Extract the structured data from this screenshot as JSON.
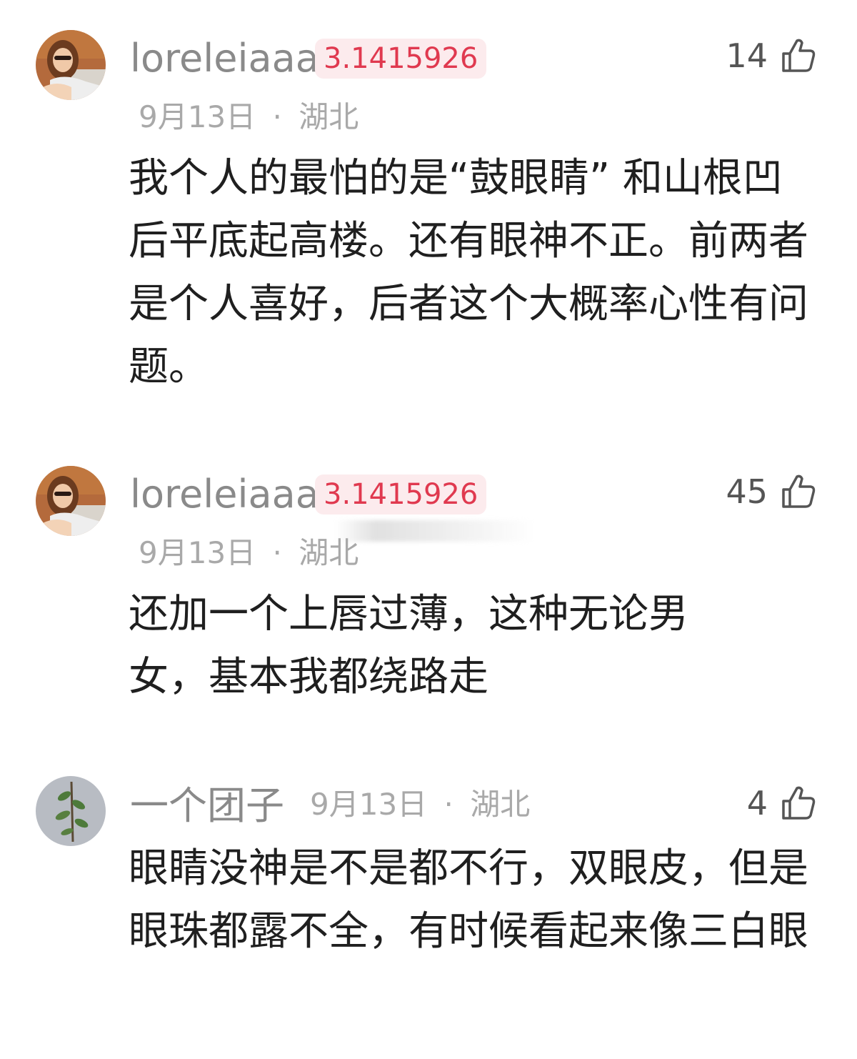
{
  "comments": [
    {
      "avatar_icon": "user-avatar-photo",
      "username": "loreleiaaa",
      "badge": "3.1415926",
      "likes": "14",
      "date": "9月13日",
      "separator": "·",
      "location": "湖北",
      "text": "我个人的最怕的是“鼓眼睛” 和山根凹后平底起高楼。还有眼神不正。前两者是个人喜好，后者这个大概率心性有问题。"
    },
    {
      "avatar_icon": "user-avatar-photo",
      "username": "loreleiaaa",
      "badge": "3.1415926",
      "likes": "45",
      "date": "9月13日",
      "separator": "·",
      "location": "湖北",
      "text": "还加一个上唇过薄，这种无论男女，基本我都绕路走"
    },
    {
      "avatar_icon": "plant-avatar-photo",
      "username": "一个团子",
      "likes": "4",
      "date": "9月13日",
      "separator": "·",
      "location": "湖北",
      "text": "眼睛没神是不是都不行，双眼皮，但是眼珠都露不全，有时候看起来像三白眼"
    }
  ],
  "colors": {
    "username": "#8a8a8a",
    "badge_text": "#e0394f",
    "badge_bg": "#fcebed",
    "meta": "#a9a9a9",
    "body": "#1f1f1f"
  }
}
